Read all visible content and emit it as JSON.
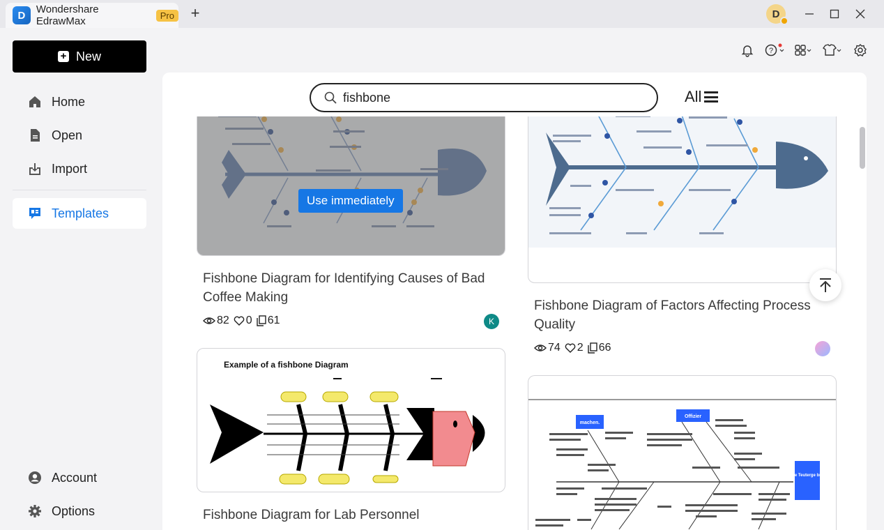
{
  "titlebar": {
    "app_name": "Wondershare EdrawMax",
    "badge": "Pro",
    "new_tab_symbol": "+",
    "user_initial": "D"
  },
  "sidebar": {
    "new_label": "New",
    "items": [
      {
        "label": "Home",
        "icon": "home-icon"
      },
      {
        "label": "Open",
        "icon": "file-icon"
      },
      {
        "label": "Import",
        "icon": "import-icon"
      },
      {
        "label": "Templates",
        "icon": "templates-icon",
        "active": true
      }
    ],
    "bottom": [
      {
        "label": "Account",
        "icon": "account-icon"
      },
      {
        "label": "Options",
        "icon": "gear-icon"
      }
    ]
  },
  "search": {
    "query": "fishbone",
    "filter_label": "All"
  },
  "cards": [
    {
      "title": "Fishbone Diagram for Identifying Causes of Bad Coffee Making",
      "views": "82",
      "likes": "0",
      "copies": "61",
      "author_initial": "K",
      "hover_button": "Use immediately"
    },
    {
      "title": "Fishbone Diagram of Factors Affecting Process Quality",
      "views": "74",
      "likes": "2",
      "copies": "66"
    },
    {
      "title": "Fishbone Diagram for Lab Personnel",
      "preview_heading": "Example of a fishbone Diagram"
    },
    {
      "title": "",
      "preview_labels": [
        "machen.",
        "Offizier",
        "Lange Teuterge bnizeit"
      ]
    }
  ],
  "colors": {
    "accent": "#1677e5",
    "primary_button": "#000000"
  }
}
